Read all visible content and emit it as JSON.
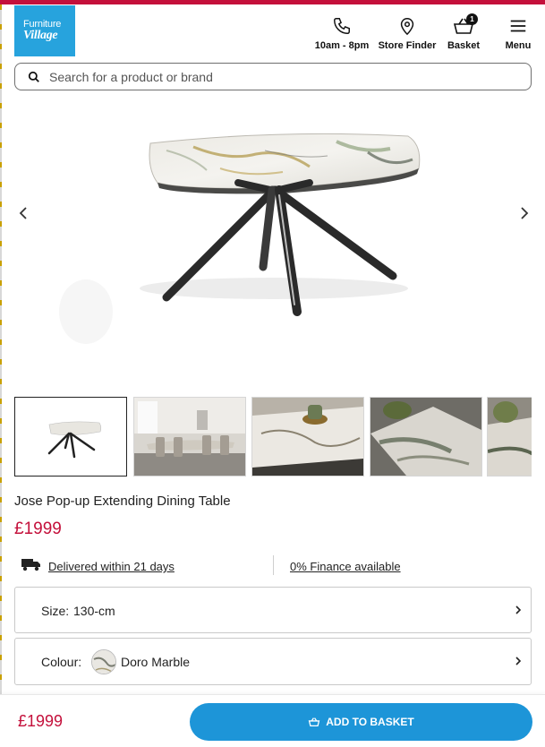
{
  "brand": {
    "logo_line1": "Furniture",
    "logo_line2": "Village",
    "accent": "#c4103b",
    "primary": "#27a3dd"
  },
  "header": {
    "hours_label": "10am - 8pm",
    "store_finder_label": "Store Finder",
    "basket_label": "Basket",
    "basket_count": "1",
    "menu_label": "Menu",
    "icons": [
      "phone-icon",
      "location-pin-icon",
      "basket-icon",
      "hamburger-menu-icon"
    ]
  },
  "search": {
    "placeholder": "Search for a product or brand",
    "value": ""
  },
  "gallery": {
    "main_image": "marble-extending-table",
    "thumbnails": [
      "table-white-background",
      "dining-room-scene",
      "tabletop-closeup-vase",
      "marble-surface-detail",
      "marble-edge-closeup"
    ]
  },
  "product": {
    "title": "Jose Pop-up Extending Dining Table",
    "price": "£1999"
  },
  "delivery": {
    "label": "Delivered within 21 days"
  },
  "finance": {
    "label": "0% Finance available"
  },
  "options": {
    "size_label": "Size:",
    "size_value": "130-cm",
    "colour_label": "Colour:",
    "colour_value": "Doro Marble"
  },
  "footer": {
    "price": "£1999",
    "button_label": "ADD TO BASKET",
    "button_color": "#1d95d8"
  }
}
